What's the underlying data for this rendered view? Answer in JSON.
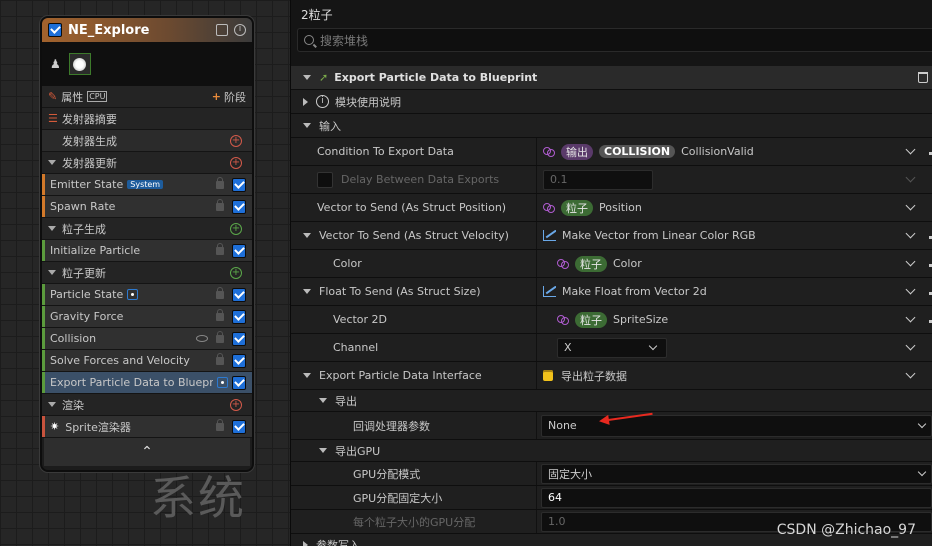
{
  "node": {
    "title": "NE_Explore",
    "props_label": "属性",
    "cpu_label": "CPU",
    "stage_label": "阶段",
    "summary_label": "发射器摘要",
    "sections": {
      "emitter_spawn": "发射器生成",
      "emitter_update": "发射器更新",
      "particle_spawn": "粒子生成",
      "particle_update": "粒子更新",
      "render": "渲染"
    },
    "modules": {
      "emitter_state": "Emitter State",
      "system_badge": "System",
      "spawn_rate": "Spawn Rate",
      "initialize_particle": "Initialize Particle",
      "particle_state": "Particle State",
      "gravity_force": "Gravity Force",
      "collision": "Collision",
      "solve_forces": "Solve Forces and Velocity",
      "export_particle": "Export Particle Data to Blueprint",
      "sprite_renderer": "Sprite渲染器"
    }
  },
  "background_text": "系统",
  "panel": {
    "title": "2粒子",
    "search_placeholder": "搜索堆栈",
    "module_header": "Export Particle Data to Blueprint",
    "module_desc": "模块使用说明",
    "inputs_label": "输入",
    "rows": {
      "condition": {
        "key": "Condition To Export Data",
        "pill1": "输出",
        "pill2": "COLLISION",
        "value": "CollisionValid"
      },
      "delay": {
        "key": "Delay Between Data Exports",
        "value": "0.1"
      },
      "vec_pos": {
        "key": "Vector to Send (As Struct Position)",
        "pill": "粒子",
        "value": "Position"
      },
      "vec_vel": {
        "key": "Vector To Send (As Struct Velocity)",
        "value": "Make Vector from Linear Color RGB"
      },
      "color": {
        "key": "Color",
        "pill": "粒子",
        "value": "Color"
      },
      "float_size": {
        "key": "Float To Send (As Struct Size)",
        "value": "Make Float from Vector 2d"
      },
      "vector2d": {
        "key": "Vector 2D",
        "pill": "粒子",
        "value": "SpriteSize"
      },
      "channel": {
        "key": "Channel",
        "value": "X"
      },
      "interface": {
        "key": "Export Particle Data Interface",
        "value": "导出粒子数据"
      },
      "export": {
        "key": "导出"
      },
      "callback": {
        "key": "回调处理器参数",
        "value": "None"
      },
      "export_gpu": {
        "key": "导出GPU"
      },
      "gpu_mode": {
        "key": "GPU分配模式",
        "value": "固定大小"
      },
      "gpu_fixed": {
        "key": "GPU分配固定大小",
        "value": "64"
      },
      "gpu_per": {
        "key": "每个粒子大小的GPU分配",
        "value": "1.0"
      },
      "param_write": {
        "key": "参数写入"
      }
    }
  },
  "watermark": "CSDN @Zhichao_97"
}
